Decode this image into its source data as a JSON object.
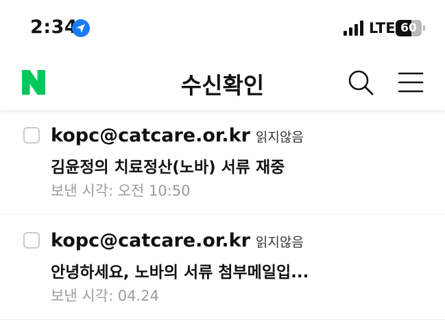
{
  "status_bar": {
    "time": "2:34",
    "network": "LTE",
    "battery_percent": "60",
    "battery_level": 0.6
  },
  "header": {
    "title": "수신확인",
    "logo_color": "#03C75A"
  },
  "mails": [
    {
      "sender": "kopc@catcare.or.kr",
      "read_status": "읽지않음",
      "subject": "김윤정의 치료정산(노바) 서류 재중",
      "sent_time": "보낸 시각: 오전 10:50"
    },
    {
      "sender": "kopc@catcare.or.kr",
      "read_status": "읽지않음",
      "subject": "안녕하세요, 노바의 서류 첨부메일입...",
      "sent_time": "보낸 시각: 04.24"
    }
  ],
  "icons": {
    "location": "location-arrow-icon",
    "signal": "cellular-signal-icon",
    "search": "search-icon",
    "menu": "hamburger-menu-icon",
    "logo": "naver-n-logo"
  }
}
